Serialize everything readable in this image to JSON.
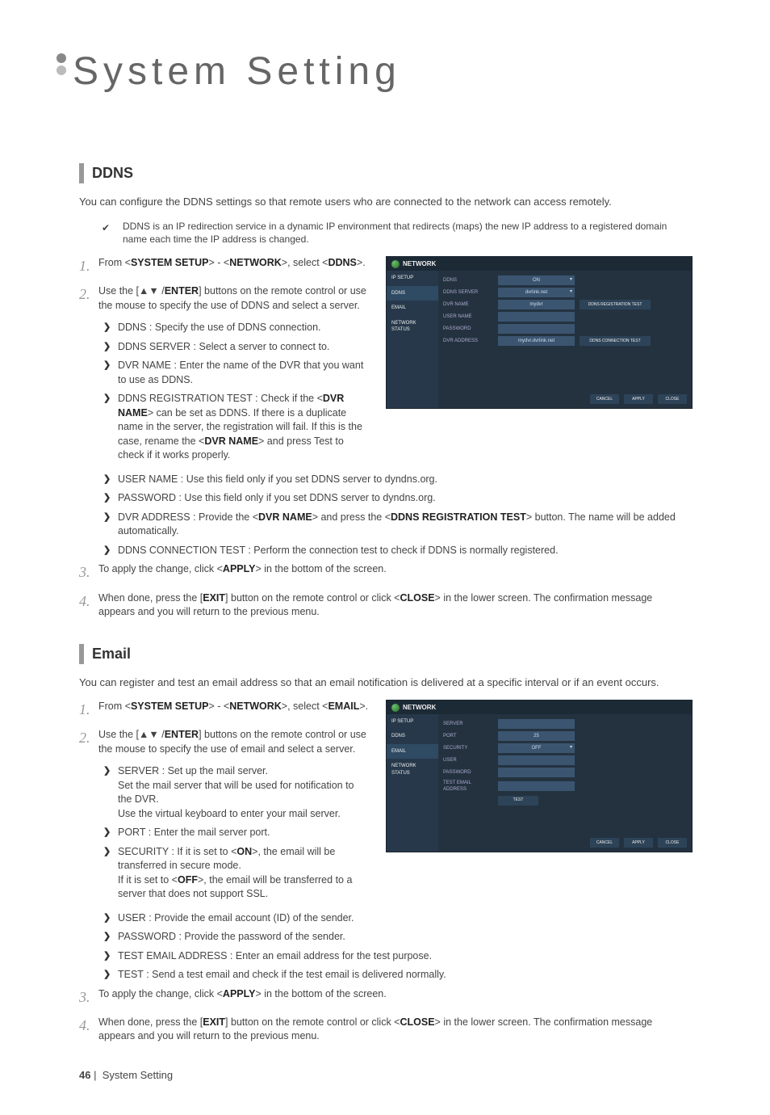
{
  "pageTitle": "System Setting",
  "footer": {
    "pageNum": "46",
    "section": "System Setting"
  },
  "ddns": {
    "heading": "DDNS",
    "intro": "You can configure the DDNS settings so that remote users who are connected to the network can access remotely.",
    "tip": "DDNS is an IP redirection service in a dynamic IP environment that redirects (maps) the new IP address to a registered domain name each time the IP address is changed.",
    "steps": [
      {
        "n": "1.",
        "textParts": [
          "From <",
          "SYSTEM SETUP",
          "> - <",
          "NETWORK",
          ">, select <",
          "DDNS",
          ">."
        ]
      },
      {
        "n": "2.",
        "textParts": [
          "Use the [▲▼    /",
          "ENTER",
          "] buttons on the remote control or use the mouse to specify the use of DDNS and select a server."
        ]
      },
      {
        "n": "3.",
        "textParts": [
          "To apply the change, click <",
          "APPLY",
          "> in the bottom of the screen."
        ]
      },
      {
        "n": "4.",
        "textParts": [
          "When done, press the [",
          "EXIT",
          "] button on the remote control or click <",
          "CLOSE",
          "> in the lower screen. The confirmation message appears and you will return to the previous menu."
        ]
      }
    ],
    "bulletsA": [
      "DDNS : Specify the use of DDNS connection.",
      "DDNS SERVER : Select a server to connect to.",
      "DVR NAME : Enter the name of the DVR that you want to use as DDNS."
    ],
    "bulletA_reg": [
      "DDNS REGISTRATION TEST : Check if the <",
      "DVR NAME",
      "> can be set as DDNS. If there is a duplicate name in the server, the registration will fail. If this is the case, rename the <",
      "DVR NAME",
      "> and press Test to check if it works properly."
    ],
    "bulletsB": [
      "USER NAME : Use this field only if you set DDNS server to dyndns.org.",
      "PASSWORD : Use this field only if you set DDNS server to dyndns.org."
    ],
    "bulletB_addr": [
      "DVR ADDRESS : Provide the <",
      "DVR NAME",
      "> and press the <",
      "DDNS REGISTRATION TEST",
      "> button. The name will be added automatically."
    ],
    "bulletB_conn": "DDNS CONNECTION TEST : Perform the connection test to check if DDNS is normally registered."
  },
  "email": {
    "heading": "Email",
    "intro": "You can register and test an email address so that an email notification is delivered at a specific interval or if an event occurs.",
    "steps": [
      {
        "n": "1.",
        "textParts": [
          "From <",
          "SYSTEM SETUP",
          "> - <",
          "NETWORK",
          ">, select <",
          "EMAIL",
          ">."
        ]
      },
      {
        "n": "2.",
        "textParts": [
          "Use the [▲▼    /",
          "ENTER",
          "] buttons on the remote control or use the mouse to specify the use of email and select a server."
        ]
      },
      {
        "n": "3.",
        "textParts": [
          "To apply the change, click <",
          "APPLY",
          "> in the bottom of the screen."
        ]
      },
      {
        "n": "4.",
        "textParts": [
          "When done, press the [",
          "EXIT",
          "] button on the remote control or click <",
          "CLOSE",
          "> in the lower screen. The confirmation message appears and you will return to the previous menu."
        ]
      }
    ],
    "bullet_server": "SERVER : Set up the mail server.\nSet the mail server that will be used for notification to the DVR.\nUse the virtual keyboard to enter your mail server.",
    "bullet_port": "PORT : Enter the mail server port.",
    "bullet_sec": [
      "SECURITY : If it is set to <",
      "ON",
      ">, the email will be transferred in secure mode.\nIf it is set to <",
      "OFF",
      ">, the email will be transferred to a server that does not support SSL."
    ],
    "bulletsB": [
      "USER : Provide the email account (ID) of the sender.",
      "PASSWORD : Provide the password of the sender.",
      "TEST EMAIL ADDRESS : Enter an email address for the test purpose.",
      "TEST : Send a test email and check if the test email is delivered normally."
    ]
  },
  "shot1": {
    "title": "NETWORK",
    "side": [
      "IP SETUP",
      "DDNS",
      "EMAIL",
      "NETWORK STATUS"
    ],
    "rows": {
      "ddns": "DDNS",
      "ddns_v": "ON",
      "server": "DDNS SERVER",
      "server_v": "dvrlink.net",
      "name": "DVR NAME",
      "name_v": "mydvr",
      "user": "USER NAME",
      "pw": "PASSWORD",
      "addr": "DVR ADDRESS",
      "addr_v": "mydvr.dvrlink.net"
    },
    "btn1": "DDNS REGISTRATION TEST",
    "btn2": "DDNS CONNECTION TEST",
    "footer": [
      "CANCEL",
      "APPLY",
      "CLOSE"
    ]
  },
  "shot2": {
    "title": "NETWORK",
    "side": [
      "IP SETUP",
      "DDNS",
      "EMAIL",
      "NETWORK STATUS"
    ],
    "rows": {
      "server": "SERVER",
      "port": "PORT",
      "port_v": "25",
      "sec": "SECURITY",
      "sec_v": "OFF",
      "user": "USER",
      "pw": "PASSWORD",
      "test": "TEST EMAIL ADDRESS"
    },
    "btn": "TEST",
    "footer": [
      "CANCEL",
      "APPLY",
      "CLOSE"
    ]
  }
}
